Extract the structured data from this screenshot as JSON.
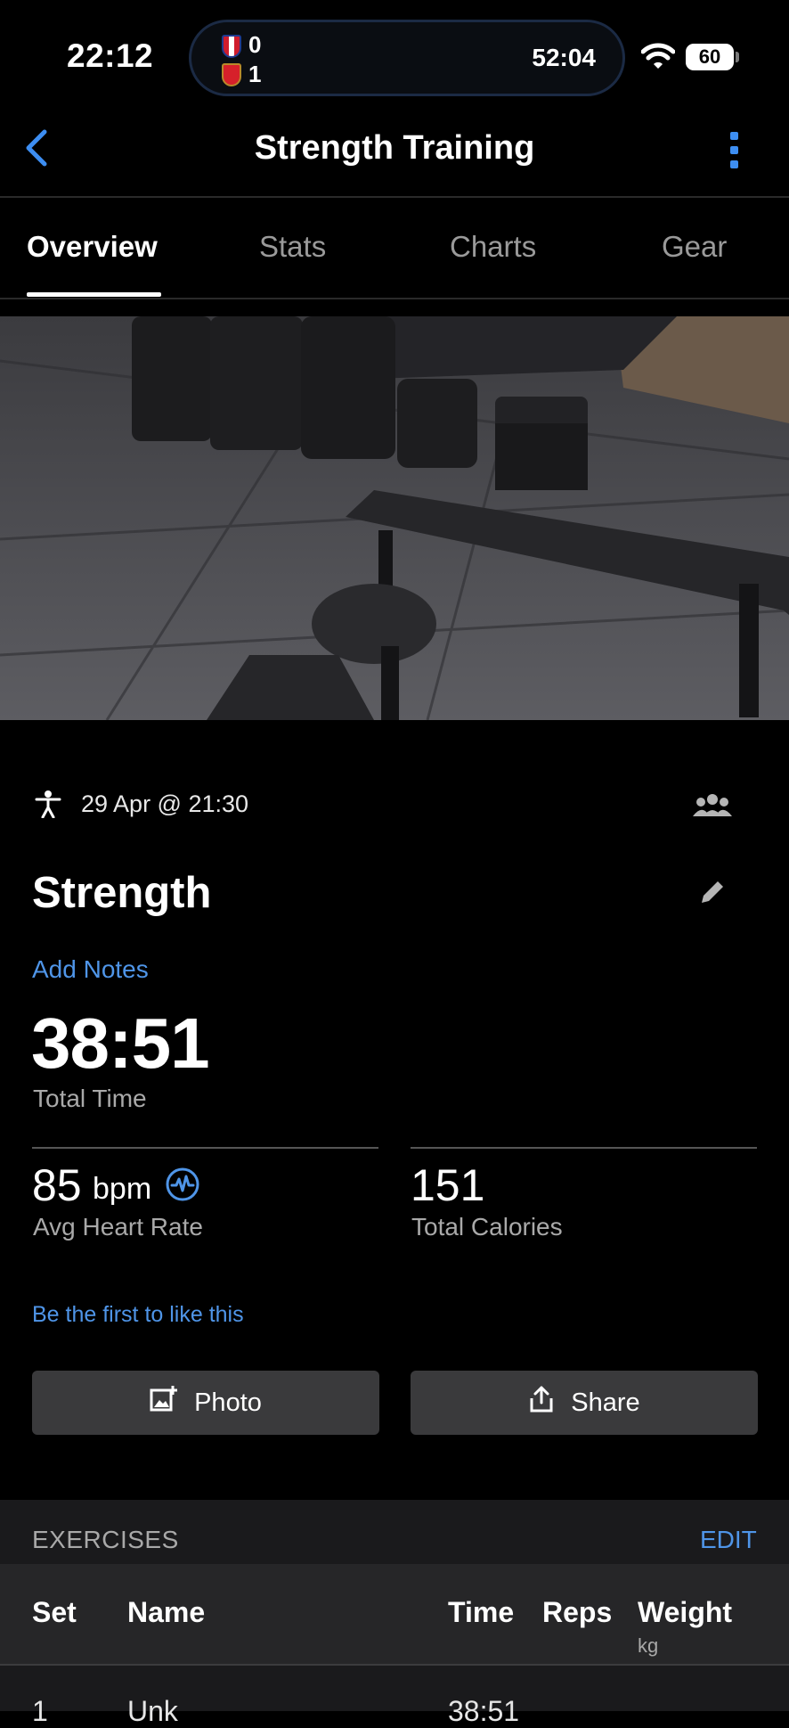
{
  "status_bar": {
    "time": "22:12",
    "live_activity": {
      "home_score": "0",
      "away_score": "1",
      "match_clock": "52:04"
    },
    "battery": "60"
  },
  "nav": {
    "title": "Strength Training"
  },
  "tabs": [
    {
      "label": "Overview",
      "active": true
    },
    {
      "label": "Stats",
      "active": false
    },
    {
      "label": "Charts",
      "active": false
    },
    {
      "label": "Gear",
      "active": false
    }
  ],
  "activity": {
    "date": "29 Apr @ 21:30",
    "name": "Strength",
    "add_notes": "Add Notes",
    "total_time": "38:51",
    "total_time_label": "Total Time",
    "avg_hr_value": "85",
    "avg_hr_unit": "bpm",
    "avg_hr_label": "Avg Heart Rate",
    "calories_value": "151",
    "calories_label": "Total Calories",
    "like_prompt": "Be the first to like this"
  },
  "buttons": {
    "photo": "Photo",
    "share": "Share"
  },
  "exercises": {
    "title": "EXERCISES",
    "edit": "EDIT",
    "columns": {
      "set": "Set",
      "name": "Name",
      "time": "Time",
      "reps": "Reps",
      "weight": "Weight",
      "weight_unit": "kg"
    },
    "rows": [
      {
        "set": "1",
        "name": "Unk",
        "time": "38:51"
      }
    ]
  },
  "colors": {
    "accent": "#4f95e8",
    "background": "#000000",
    "button": "#3a3a3c"
  }
}
